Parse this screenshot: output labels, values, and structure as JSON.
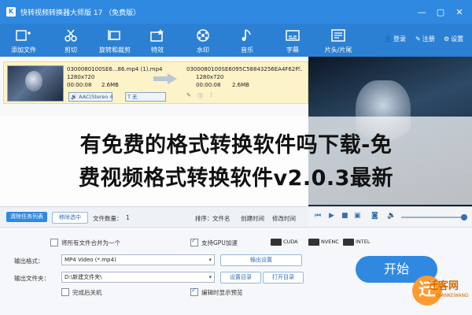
{
  "window": {
    "title": "快转视频转换器大师版 17 （免费版）",
    "app_icon": "K"
  },
  "toolbar": {
    "items": [
      {
        "label": "添加文件",
        "icon": "add-file-icon"
      },
      {
        "label": "剪切",
        "icon": "scissors-icon"
      },
      {
        "label": "旋转和裁剪",
        "icon": "rotate-crop-icon"
      },
      {
        "label": "特效",
        "icon": "effects-icon"
      },
      {
        "label": "水印",
        "icon": "watermark-icon"
      },
      {
        "label": "音乐",
        "icon": "music-icon"
      },
      {
        "label": "字幕",
        "icon": "subtitle-icon"
      },
      {
        "label": "片头/片尾",
        "icon": "intro-outro-icon"
      }
    ],
    "right": {
      "login": "登录",
      "register": "注册",
      "settings": "设置"
    }
  },
  "file": {
    "source_name": "0300080100SE6...86.mp4 (1).mp4",
    "source_res": "1280x720",
    "source_time": "00:00:08",
    "source_size": "2.6MB",
    "target_name": "0300080100SE6095C58843256EA4F62F...",
    "target_res": "1280x720",
    "target_time": "00:00:08",
    "target_size": "2.6MB",
    "audio": "AAC(Stereo 4",
    "subtitle": "无"
  },
  "list_controls": {
    "clear": "清除任务列表",
    "remove": "移除选中",
    "count_label": "文件数量：",
    "count": "1",
    "sort_label": "排序：",
    "sort_name": "文件名",
    "sort_created": "创建时间",
    "sort_modified": "修改时间"
  },
  "settings": {
    "merge_label": "将所有文件合并为一个",
    "gpu_label": "支持GPU加速",
    "accel": [
      "CUDA",
      "NVENC",
      "INTEL"
    ],
    "format_label": "输出格式：",
    "format_value": "MP4 Video (*.mp4)",
    "output_settings": "输出设置",
    "folder_label": "输出文件夹：",
    "folder_value": "D:\\新建文件夹\\",
    "set_folder": "设置目录",
    "open_folder": "打开目录",
    "shutdown_label": "完成后关机",
    "preview_label": "编辑时显示预览",
    "start": "开始"
  },
  "overlay": {
    "line1": "有免费的格式转换软件吗下载-免",
    "line2": "费视频格式转换软件v2.0.3最新"
  },
  "badge": {
    "name": "迁客网",
    "sub": "QIANKEWANG"
  },
  "colors": {
    "title_bar": "#2f89e0",
    "toolbar": "#2c80d3",
    "start": "#2f89e0",
    "badge": "#ff9a2e"
  }
}
